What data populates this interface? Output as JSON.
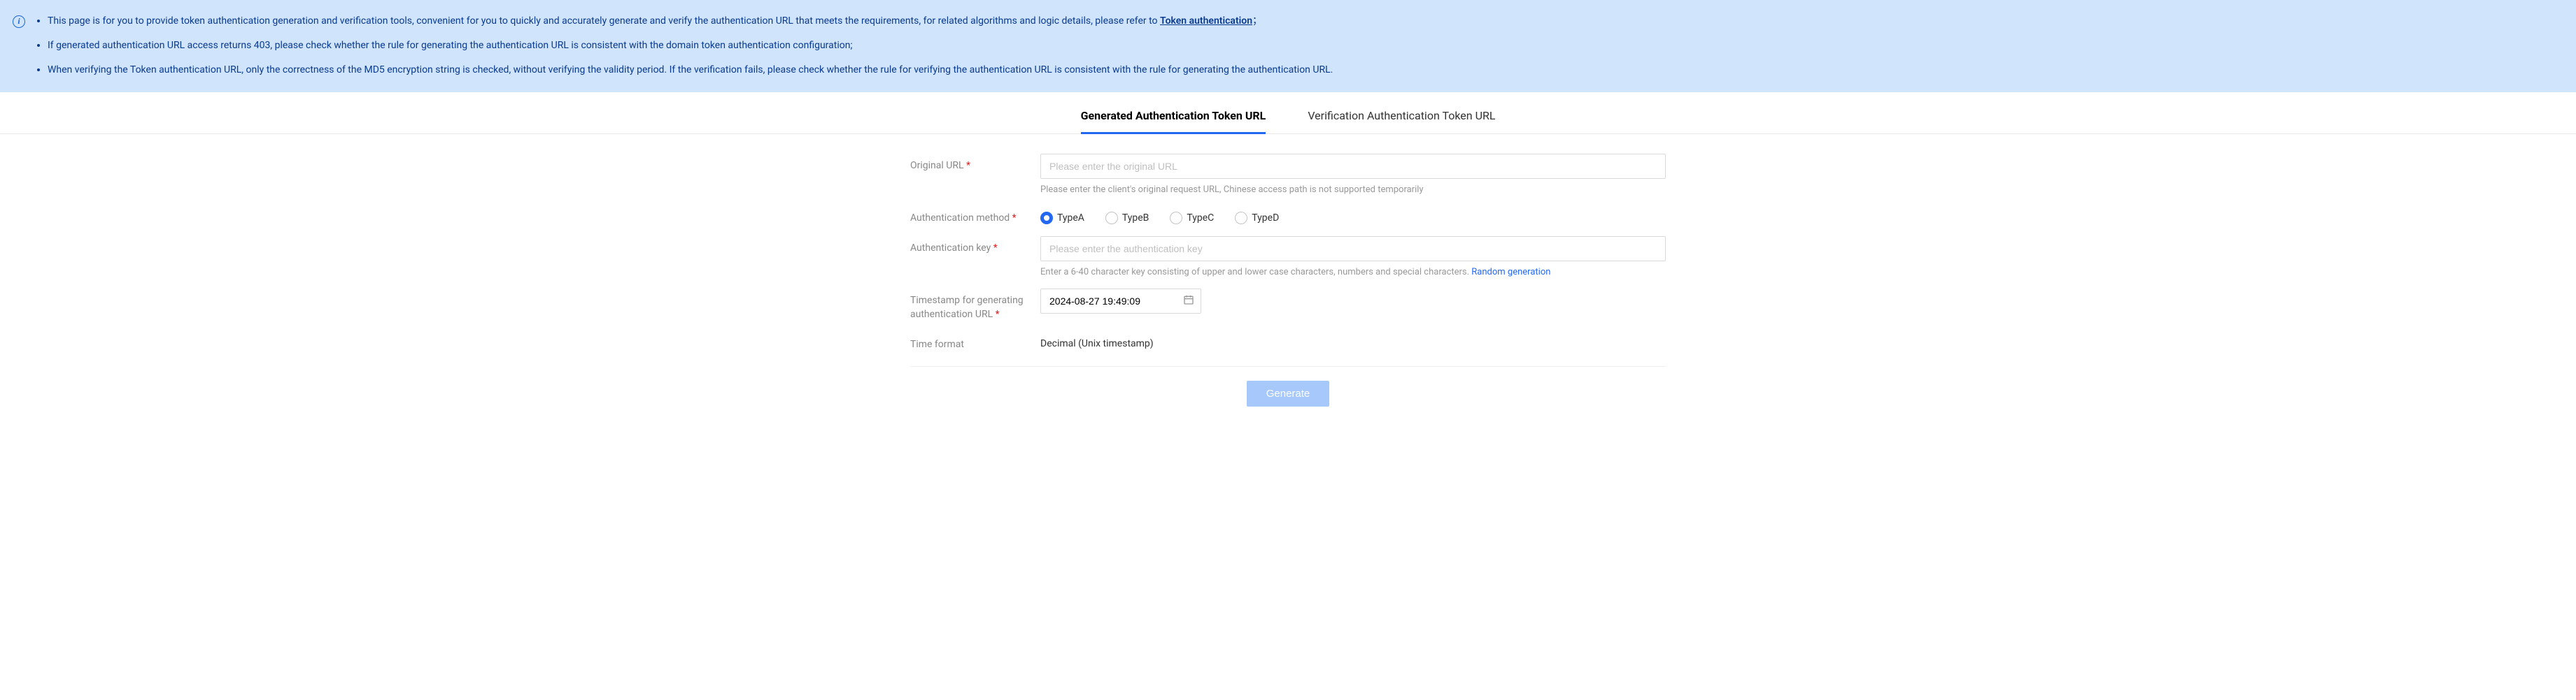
{
  "info": {
    "bullets": [
      {
        "prefix": "This page is for you to provide token authentication generation and verification tools, convenient for you to quickly and accurately generate and verify the authentication URL that meets the requirements, for related algorithms and logic details, please refer to ",
        "link": "Token authentication",
        "suffix": "；"
      },
      {
        "text": "If generated authentication URL access returns 403, please check whether the rule for generating the authentication URL is consistent with the domain token authentication configuration;"
      },
      {
        "text": "When verifying the Token authentication URL, only the correctness of the MD5 encryption string is checked, without verifying the validity period. If the verification fails, please check whether the rule for verifying the authentication URL is consistent with the rule for generating the authentication URL."
      }
    ]
  },
  "tabs": {
    "generate": "Generated Authentication Token URL",
    "verify": "Verification Authentication Token URL"
  },
  "form": {
    "original_url": {
      "label": "Original URL",
      "placeholder": "Please enter the original URL",
      "hint": "Please enter the client's original request URL, Chinese access path is not supported temporarily"
    },
    "auth_method": {
      "label": "Authentication method",
      "options": {
        "a": "TypeA",
        "b": "TypeB",
        "c": "TypeC",
        "d": "TypeD"
      }
    },
    "auth_key": {
      "label": "Authentication key",
      "placeholder": "Please enter the authentication key",
      "hint_prefix": "Enter a 6-40 character key consisting of upper and lower case characters, numbers and special characters. ",
      "hint_link": "Random generation"
    },
    "timestamp": {
      "label": "Timestamp for generating authentication URL",
      "value": "2024-08-27 19:49:09"
    },
    "time_format": {
      "label": "Time format",
      "value": "Decimal (Unix timestamp)"
    }
  },
  "buttons": {
    "generate": "Generate"
  }
}
